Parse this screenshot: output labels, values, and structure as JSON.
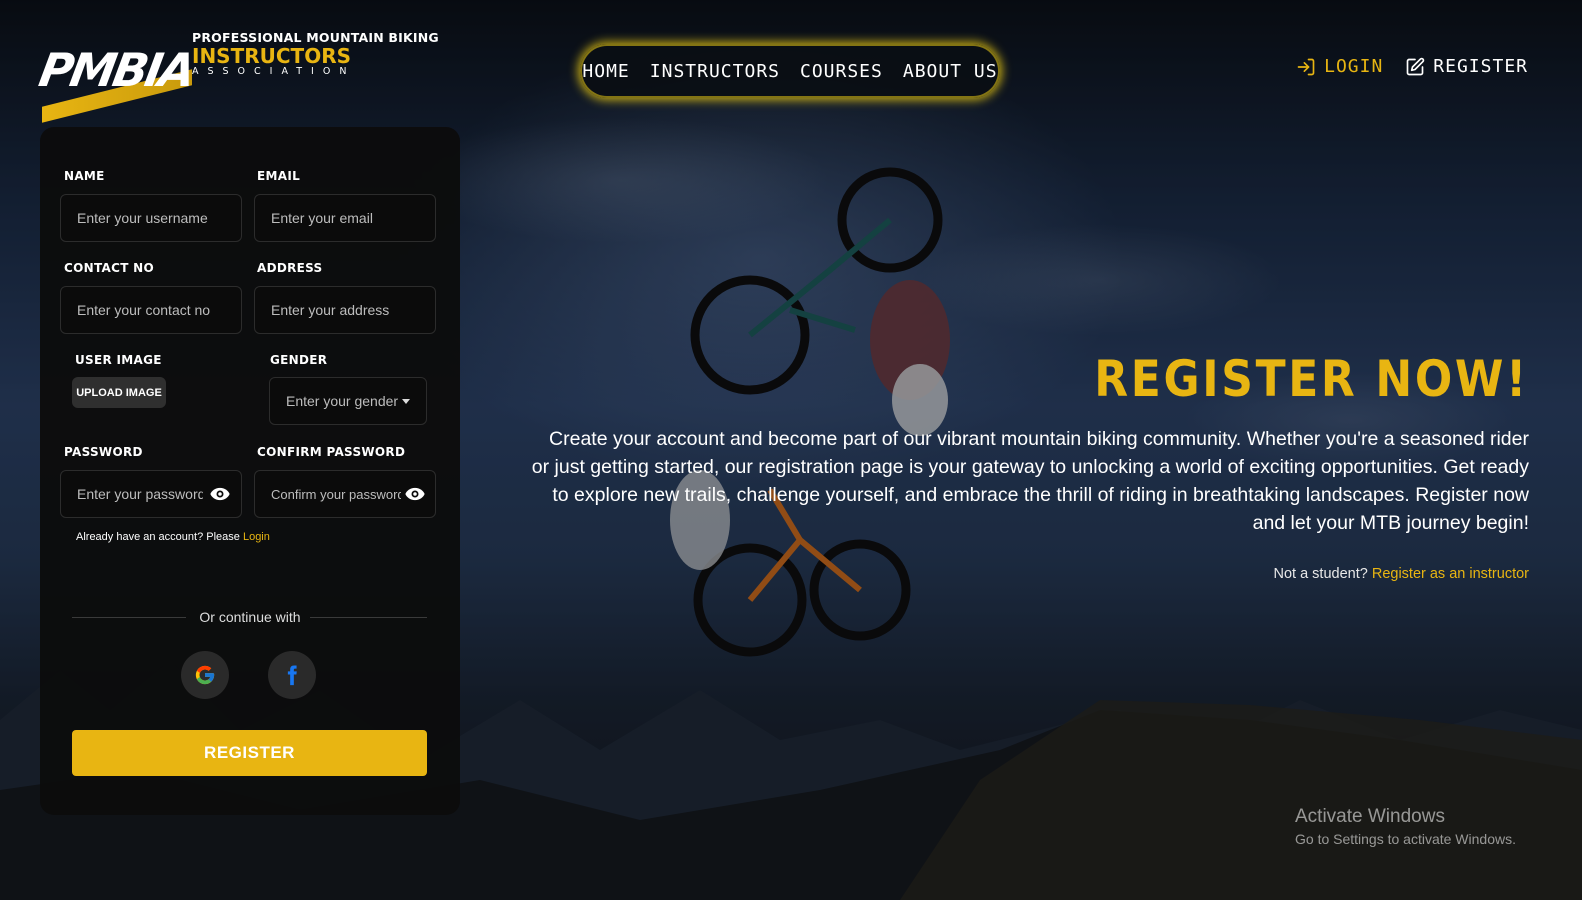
{
  "brand": {
    "logo_mark": "PMBIA",
    "line1": "PROFESSIONAL MOUNTAIN BIKING",
    "line2": "INSTRUCTORS",
    "line3": "ASSOCIATION"
  },
  "nav": {
    "items": [
      "HOME",
      "INSTRUCTORS",
      "COURSES",
      "ABOUT US"
    ]
  },
  "auth": {
    "login": "LOGIN",
    "register": "REGISTER"
  },
  "form": {
    "name": {
      "label": "NAME",
      "placeholder": "Enter your username"
    },
    "email": {
      "label": "EMAIL",
      "placeholder": "Enter your email"
    },
    "contact": {
      "label": "CONTACT NO",
      "placeholder": "Enter your contact no"
    },
    "address": {
      "label": "ADDRESS",
      "placeholder": "Enter your address"
    },
    "image": {
      "label": "USER IMAGE",
      "button": "UPLOAD IMAGE"
    },
    "gender": {
      "label": "GENDER",
      "placeholder": "Enter your gender"
    },
    "password": {
      "label": "PASSWORD",
      "placeholder": "Enter your password"
    },
    "confirm": {
      "label": "CONFIRM PASSWORD",
      "placeholder": "Confirm your password"
    },
    "login_hint": "Already have an account? Please",
    "login_link": "Login",
    "divider": "Or continue with",
    "social": [
      "google-icon",
      "facebook-icon"
    ],
    "submit": "REGISTER"
  },
  "hero": {
    "title": "REGISTER NOW!",
    "description": "Create your account and become part of our vibrant mountain biking community. Whether you're a seasoned rider or just getting started, our registration page is your gateway to unlocking a world of exciting opportunities. Get ready to explore new trails, challenge yourself, and embrace the thrill of riding in breathtaking landscapes. Register now and let your MTB journey begin!",
    "note": "Not a student?",
    "note_link": "Register as an instructor"
  },
  "watermark": {
    "title": "Activate Windows",
    "subtitle": "Go to Settings to activate Windows."
  },
  "colors": {
    "accent": "#e8b512",
    "panel": "#0c0c0c"
  }
}
